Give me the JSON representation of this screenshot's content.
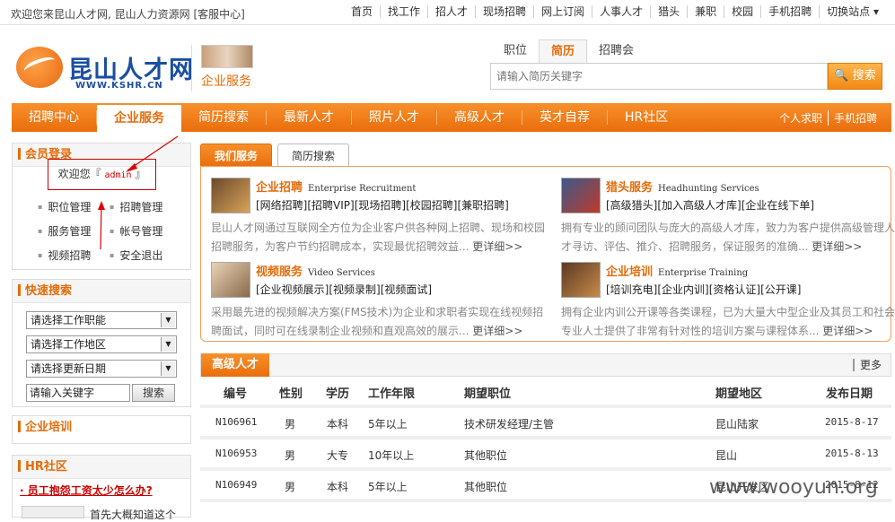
{
  "topbar": {
    "welcome": "欢迎您来昆山人才网, 昆山人力资源网 [客服中心]",
    "links": [
      "首页",
      "找工作",
      "招人才",
      "现场招聘",
      "网上订阅",
      "人事人才",
      "猎头",
      "兼职",
      "校园",
      "手机招聘",
      "切换站点 ▾"
    ]
  },
  "logo": {
    "name": "昆山人才网",
    "url": "WWW.KSHR.CN"
  },
  "qiye_label": "企业服务",
  "search": {
    "tabs": [
      "职位",
      "简历",
      "招聘会"
    ],
    "active_tab": "简历",
    "placeholder": "请输入简历关键字",
    "button": "搜索"
  },
  "nav": {
    "items": [
      "招聘中心",
      "企业服务",
      "简历搜索",
      "最新人才",
      "照片人才",
      "高级人才",
      "英才自荐",
      "HR社区"
    ],
    "active": "企业服务",
    "right": [
      "个人求职",
      "手机招聘"
    ]
  },
  "login": {
    "title": "会员登录",
    "hello_prefix": "欢迎您『",
    "user": "admin",
    "hello_suffix": "』",
    "menu": [
      "职位管理",
      "招聘管理",
      "服务管理",
      "帐号管理",
      "视频招聘",
      "安全退出"
    ]
  },
  "quick": {
    "title": "快速搜索",
    "selects": [
      "请选择工作职能",
      "请选择工作地区",
      "请选择更新日期"
    ],
    "keyword": "请输入关键字",
    "button": "搜索"
  },
  "training_title": "企业培训",
  "hr": {
    "title": "HR社区",
    "headline": "· 员工抱怨工资太少怎么办?",
    "snippet": "首先大概知道这个"
  },
  "main_tabs": [
    "我们服务",
    "简历搜索"
  ],
  "services": [
    {
      "title": "企业招聘",
      "en": "Enterprise Recruitment",
      "sub": "[网络招聘][招聘VIP][现场招聘][校园招聘][兼职招聘]",
      "desc": "昆山人才网通过互联网全方位为企业客户供各种网上招聘、现场和校园招聘服务，为客户节约招聘成本，实现最优招聘效益...",
      "more": "更详细>>"
    },
    {
      "title": "猎头服务",
      "en": "Headhunting Services",
      "sub": "[高级猎头][加入高级人才库][企业在线下单]",
      "desc": "拥有专业的顾问团队与庞大的高级人才库，致力为客户提供高级管理人才寻访、评估、推介、招聘服务，保证服务的准确...",
      "more": "更详细>>"
    },
    {
      "title": "视频服务",
      "en": "Video Services",
      "sub": "[企业视频展示][视频录制][视频面试]",
      "desc": "采用最先进的视频解决方案(FMS技术)为企业和求职者实现在线视频招聘面试，同时可在线录制企业视频和直观高效的展示...",
      "more": "更详细>>"
    },
    {
      "title": "企业培训",
      "en": "Enterprise Training",
      "sub": "[培训充电][企业内训][资格认证][公开课]",
      "desc": "拥有企业内训公开课等各类课程，已为大量大中型企业及其员工和社会专业人士提供了非常有针对性的培训方案与课程体系...",
      "more": "更详细>>"
    }
  ],
  "senior": {
    "title": "高级人才",
    "more": "更多",
    "headers": [
      "编号",
      "性别",
      "学历",
      "工作年限",
      "期望职位",
      "期望地区",
      "发布日期"
    ],
    "rows": [
      [
        "N106961",
        "男",
        "本科",
        "5年以上",
        "技术研发经理/主管",
        "昆山陆家",
        "2015-8-17"
      ],
      [
        "N106953",
        "男",
        "大专",
        "10年以上",
        "其他职位",
        "昆山",
        "2015-8-13"
      ],
      [
        "N106949",
        "男",
        "本科",
        "5年以上",
        "其他职位",
        "昆山开发区",
        "2015-8-12"
      ]
    ]
  },
  "watermark": "www.wooyun.org"
}
